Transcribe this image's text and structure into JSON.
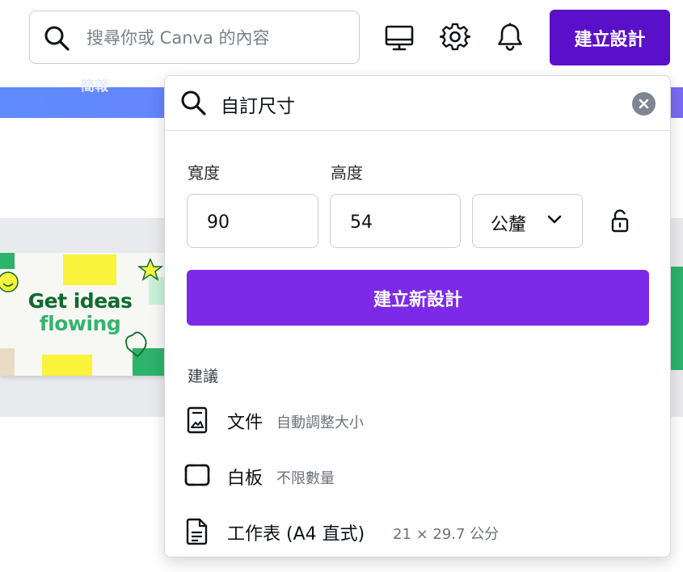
{
  "header": {
    "search_placeholder": "搜尋你或 Canva 的內容",
    "create_button": "建立設計",
    "icons": [
      "search-icon",
      "monitor-icon",
      "gear-icon",
      "bell-icon"
    ]
  },
  "background": {
    "banner_text": "簡報",
    "card_line1": "Get ideas",
    "card_line2": "flowing"
  },
  "panel": {
    "search_value": "自訂尺寸",
    "width_label": "寬度",
    "height_label": "高度",
    "width_value": "90",
    "height_value": "54",
    "unit": "公釐",
    "create_new": "建立新設計",
    "suggestions_title": "建議",
    "suggestions": [
      {
        "name": "文件",
        "sub": "自動調整大小",
        "icon": "document-icon"
      },
      {
        "name": "白板",
        "sub": "不限數量",
        "icon": "whiteboard-icon"
      },
      {
        "name": "工作表 (A4 直式)",
        "sub": "21 × 29.7 公分",
        "icon": "worksheet-icon"
      }
    ]
  },
  "colors": {
    "brand_purple": "#5a0fc8",
    "create_new_purple": "#7d2ae8",
    "banner_blue": "#5f8bff"
  }
}
